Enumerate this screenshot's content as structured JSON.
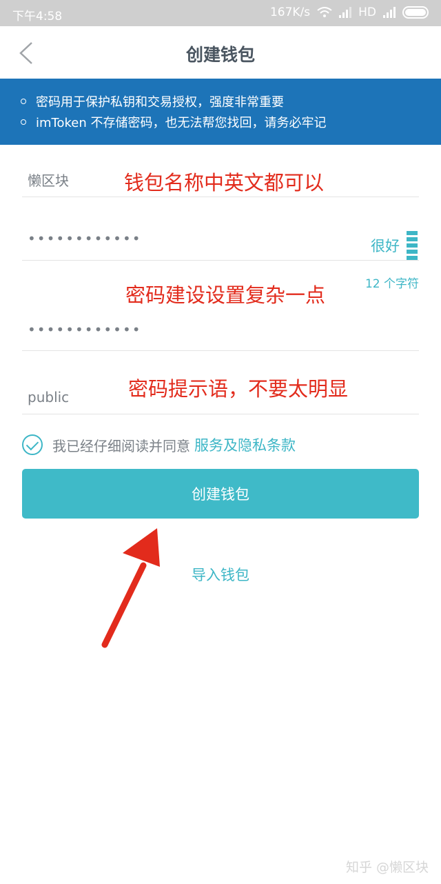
{
  "status_bar": {
    "time": "下午4:58",
    "speed": "167K/s",
    "network": "HD"
  },
  "nav": {
    "back_icon": "chevron-left-icon",
    "title": "创建钱包"
  },
  "notice": {
    "lines": [
      "密码用于保护私钥和交易授权，强度非常重要",
      "imToken 不存储密码，也无法帮您找回，请务必牢记"
    ]
  },
  "form": {
    "wallet_name": "懒区块",
    "password": "••••••••••••",
    "password_strength": "很好",
    "char_count": "12 个字符",
    "password_confirm": "••••••••••••",
    "hint": "public"
  },
  "annotations": {
    "name_note": "钱包名称中英文都可以",
    "password_note": "密码建设设置复杂一点",
    "hint_note": "密码提示语，不要太明显"
  },
  "agreement": {
    "checked": true,
    "text": "我已经仔细阅读并同意",
    "link": "服务及隐私条款"
  },
  "buttons": {
    "create": "创建钱包",
    "import": "导入钱包"
  },
  "watermark": "知乎 @懒区块",
  "colors": {
    "accent": "#3fbac8",
    "notice_bg": "#1d74b8",
    "annotation": "#e22b1c"
  }
}
